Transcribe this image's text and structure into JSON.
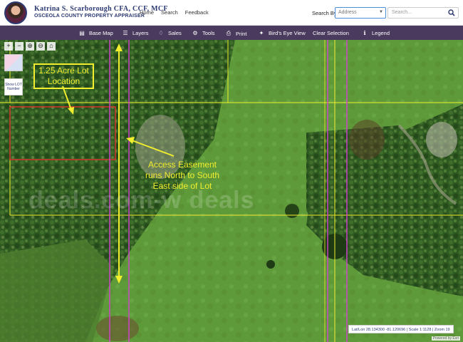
{
  "header": {
    "name": "Katrina S. Scarborough CFA, CCF, MCF",
    "subtitle": "OSCEOLA COUNTY PROPERTY APPRAISER",
    "nav": [
      "Home",
      "Search",
      "Feedback"
    ],
    "search_by_label": "Search By",
    "search_by_value": "Address",
    "search_placeholder": "Search..."
  },
  "toolbar": {
    "items": [
      {
        "label": "Base Map",
        "icon": "map-icon"
      },
      {
        "label": "Layers",
        "icon": "layers-icon"
      },
      {
        "label": "Sales",
        "icon": "bell-icon"
      },
      {
        "label": "Tools",
        "icon": "gear-icon"
      },
      {
        "label": "Print",
        "icon": "printer-icon"
      },
      {
        "label": "Bird's Eye View",
        "icon": "bird-icon"
      },
      {
        "label": "Clear Selection",
        "icon": ""
      },
      {
        "label": "Legend",
        "icon": "info-icon"
      }
    ]
  },
  "map": {
    "lot_label": "1.25 Acre Lot Location",
    "easement_label": "Access Easement runs North to South East side of Lot",
    "watermark": "deals.com-w     deals",
    "lot_toggle_label": "Show LOT Number",
    "scale_readout": "Lat/Lon 28.134300 -81.120696 | Scale 1:1128 | Zoom 19",
    "powered_by": "Powered by Esri",
    "colors": {
      "parcel_line": "#f2ee2e",
      "lot_outline": "#e0342c",
      "road_line": "#d63fd6",
      "brand": "#2c3a73",
      "toolbar": "#4a3a5e"
    }
  }
}
